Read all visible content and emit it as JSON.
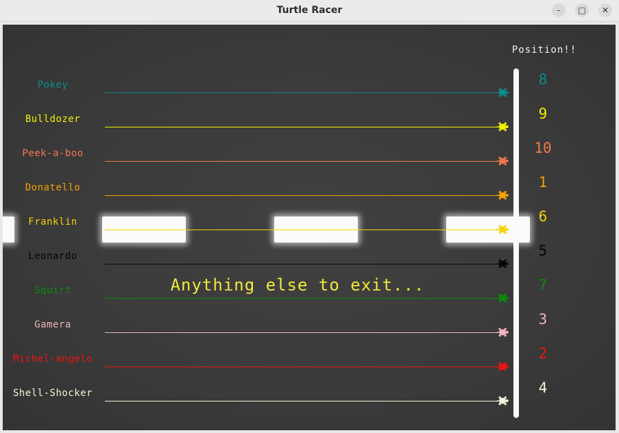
{
  "window": {
    "title": "Turtle Racer",
    "minimize_glyph": "–",
    "maximize_glyph": "□",
    "close_glyph": "✕"
  },
  "race": {
    "heading": "Position!!",
    "message": "Anything else to exit...",
    "racers": [
      {
        "name": "Pokey",
        "color": "#0e8c8c",
        "position": "8"
      },
      {
        "name": "Bulldozer",
        "color": "#f5f000",
        "position": "9"
      },
      {
        "name": "Peek-a-boo",
        "color": "#f0784f",
        "position": "10"
      },
      {
        "name": "Donatello",
        "color": "#f5a100",
        "position": "1"
      },
      {
        "name": "Franklin",
        "color": "#f5d200",
        "position": "6"
      },
      {
        "name": "Leonardo",
        "color": "#050505",
        "position": "5"
      },
      {
        "name": "Squirt",
        "color": "#0c8a0c",
        "position": "7"
      },
      {
        "name": "Gamera",
        "color": "#f0b6c0",
        "position": "3"
      },
      {
        "name": "Michel-angelo",
        "color": "#f01414",
        "position": "2"
      },
      {
        "name": "Shell-Shocker",
        "color": "#f4f4dc",
        "position": "4"
      }
    ]
  }
}
